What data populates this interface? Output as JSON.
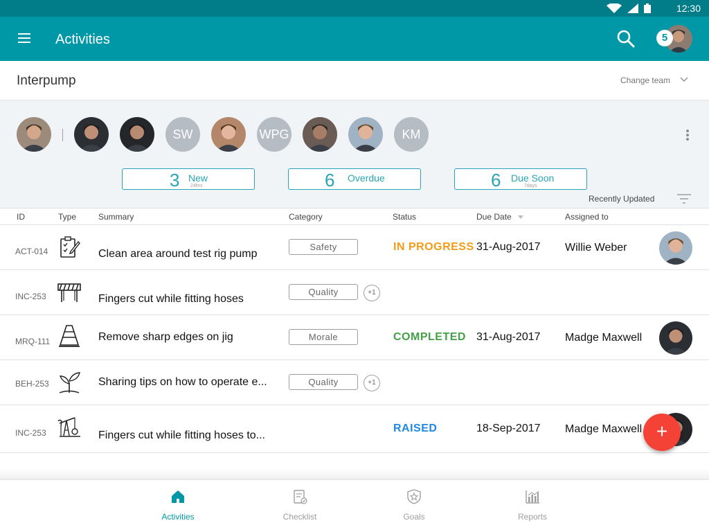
{
  "status_bar": {
    "time": "12:30"
  },
  "app_bar": {
    "title": "Activities",
    "notification_count": "5"
  },
  "team": {
    "name": "Interpump",
    "change_label": "Change team"
  },
  "members": [
    {
      "type": "photo",
      "name": "member-1",
      "skin": "#d4a78b",
      "hair": "#4a3426",
      "bg": "#9c8a7a"
    },
    {
      "type": "photo",
      "name": "member-2",
      "skin": "#c08f77",
      "hair": "#1d1d1d",
      "bg": "#2b2e33"
    },
    {
      "type": "photo",
      "name": "member-3",
      "skin": "#b98a72",
      "hair": "#1a1a1a",
      "bg": "#24262a"
    },
    {
      "type": "initials",
      "initials": "SW"
    },
    {
      "type": "photo",
      "name": "member-5",
      "skin": "#e2b79d",
      "hair": "#5a3a22",
      "bg": "#b4876a"
    },
    {
      "type": "initials",
      "initials": "WPG"
    },
    {
      "type": "photo",
      "name": "member-7",
      "skin": "#a87d66",
      "hair": "#2a2a2a",
      "bg": "#6a5b55"
    },
    {
      "type": "photo",
      "name": "member-8",
      "skin": "#e0b39a",
      "hair": "#6b4a2b",
      "bg": "#9fb3c4"
    },
    {
      "type": "initials",
      "initials": "KM"
    }
  ],
  "summary_chips": [
    {
      "count": "3",
      "label": "New",
      "sub": "24hrs"
    },
    {
      "count": "6",
      "label": "Overdue",
      "sub": ""
    },
    {
      "count": "6",
      "label": "Due Soon",
      "sub": "7days"
    }
  ],
  "sort": {
    "label": "Recently Updated"
  },
  "table": {
    "headers": {
      "id": "ID",
      "type": "Type",
      "summary": "Summary",
      "category": "Category",
      "status": "Status",
      "due": "Due Date",
      "assigned": "Assigned to"
    },
    "rows": [
      {
        "id": "ACT-014",
        "type_icon": "checklist-icon",
        "summary": "Clean area around test rig pump",
        "category": "Safety",
        "extra": "",
        "status": "IN PROGRESS",
        "status_color": "#f59a16",
        "due": "31-Aug-2017",
        "assignee": "Willie Weber",
        "avatar": {
          "skin": "#e0b39a",
          "hair": "#6b4a2b",
          "bg": "#9fb3c4"
        }
      },
      {
        "id": "INC-253",
        "type_icon": "barrier-icon",
        "summary": "Fingers cut while fitting hoses",
        "category": "Quality",
        "extra": "+1",
        "status": "",
        "status_color": "",
        "due": "",
        "assignee": "",
        "avatar": null
      },
      {
        "id": "MRQ-111",
        "type_icon": "cone-icon",
        "summary": "Remove sharp edges on jig",
        "category": "Morale",
        "extra": "",
        "status": "COMPLETED",
        "status_color": "#43a047",
        "due": "31-Aug-2017",
        "assignee": "Madge Maxwell",
        "avatar": {
          "skin": "#c08f77",
          "hair": "#1d1d1d",
          "bg": "#2b2e33"
        }
      },
      {
        "id": "BEH-253",
        "type_icon": "sprout-icon",
        "summary": "Sharing tips on how to operate e...",
        "category": "Quality",
        "extra": "+1",
        "status": "",
        "status_color": "",
        "due": "",
        "assignee": "",
        "avatar": null
      },
      {
        "id": "INC-253",
        "type_icon": "pump-jack-icon",
        "summary": "Fingers cut while fitting hoses to...",
        "category": "",
        "extra": "",
        "status": "RAISED",
        "status_color": "#1e88e5",
        "due": "18-Sep-2017",
        "assignee": "Madge Maxwell",
        "avatar": {
          "skin": "#b98a72",
          "hair": "#1a1a1a",
          "bg": "#24262a"
        }
      }
    ]
  },
  "fab": {
    "label": "+"
  },
  "bottom_nav": [
    {
      "label": "Activities",
      "icon": "home-icon",
      "active": true
    },
    {
      "label": "Checklist",
      "icon": "checklist-nav-icon",
      "active": false
    },
    {
      "label": "Goals",
      "icon": "shield-star-icon",
      "active": false
    },
    {
      "label": "Reports",
      "icon": "bar-chart-icon",
      "active": false
    }
  ],
  "colors": {
    "primary": "#0097a7",
    "status_bar": "#007d88",
    "accent": "#f44336",
    "chip": "#28a4b4"
  }
}
